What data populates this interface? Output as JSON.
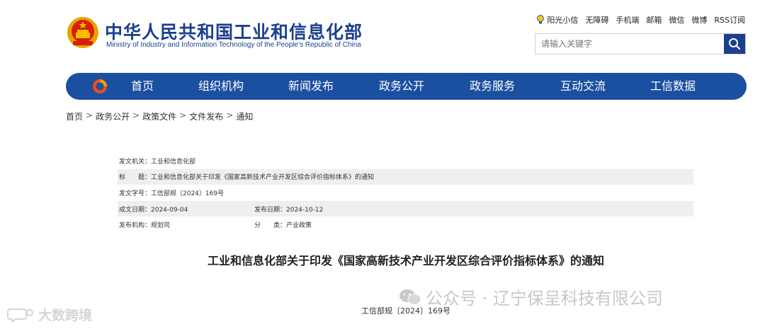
{
  "header": {
    "title_cn": "中华人民共和国工业和信息化部",
    "title_en": "Ministry of Industry and Information Technology of the People’s Republic of China",
    "links": [
      "阳光小信",
      "无障碍",
      "手机端",
      "邮箱",
      "微信",
      "微博",
      "RSS订阅"
    ],
    "search_placeholder": "请输入关键字"
  },
  "nav": {
    "items": [
      "首页",
      "组织机构",
      "新闻发布",
      "政务公开",
      "政务服务",
      "互动交流",
      "工信数据"
    ]
  },
  "breadcrumb": [
    "首页",
    "政务公开",
    "政策文件",
    "文件发布",
    "通知"
  ],
  "breadcrumb_sep": ">",
  "meta": {
    "issuer": "发文机关：工业和信息化部",
    "subject": "标　　题：工业和信息化部关于印发《国家高新技术产业开发区综合评价指标体系》的通知",
    "doc_no": "发文字号：工信部规〔2024〕169号",
    "created": "成文日期：2024-09-04",
    "published": "发布日期：2024-10-12",
    "org": "发布机构：规划司",
    "category": "分　　类：产业政策"
  },
  "article": {
    "title": "工业和信息化部关于印发《国家高新技术产业开发区综合评价指标体系》的通知",
    "doc_no": "工信部规〔2024〕169号"
  },
  "watermarks": {
    "right": "公众号 · 辽宁保呈科技有限公司",
    "left": "大数跨境"
  },
  "colors": {
    "brand_blue": "#1b4fa0",
    "title_blue": "#1b3f8f",
    "row_gray": "#efefef"
  }
}
